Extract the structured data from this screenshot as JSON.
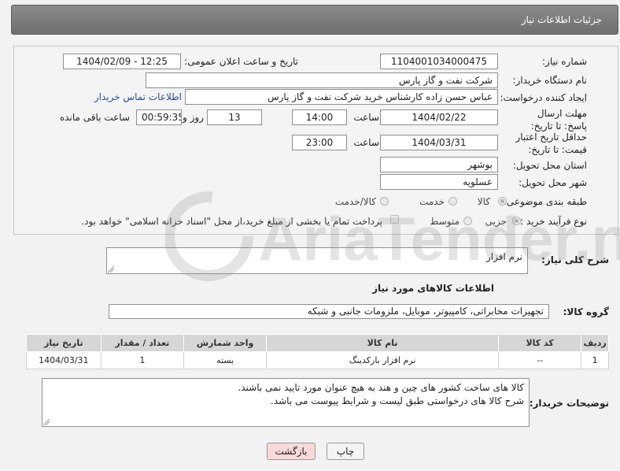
{
  "header": {
    "title": "جزئیات اطلاعات نیاز"
  },
  "form": {
    "need_number_label": "شماره نیاز:",
    "need_number": "1104001034000475",
    "announce_label": "تاریخ و ساعت اعلان عمومی:",
    "announce_value": "1404/02/09 - 12:25",
    "buyer_org_label": "نام دستگاه خریدار:",
    "buyer_org": "شرکت نفت و گاز پارس",
    "creator_label": "ایجاد کننده درخواست:",
    "creator": "عباس حسن زاده کارشناس خرید شرکت نفت و گاز پارس",
    "contact_link": "اطلاعات تماس خریدار",
    "deadline_label": "مهلت ارسال پاسخ: تا تاریخ:",
    "deadline_date": "1404/02/22",
    "time_label": "ساعت",
    "deadline_time": "14:00",
    "days_value": "13",
    "days_label": "روز و",
    "remaining_value": "00:59:35",
    "remaining_label": "ساعت باقی مانده",
    "validity_label": "حداقل تاریخ اعتبار قیمت: تا تاریخ:",
    "validity_date": "1404/03/31",
    "validity_time": "23:00",
    "province_label": "استان محل تحویل:",
    "province": "بوشهر",
    "city_label": "شهر محل تحویل:",
    "city": "عسلویه",
    "category_label": "طبقه بندی موضوعی:",
    "category_options": [
      "کالا",
      "خدمت",
      "کالا/خدمت"
    ],
    "category_selected": "کالا",
    "process_label": "نوع فرآیند خرید :",
    "process_options": [
      "جزیی",
      "متوسط"
    ],
    "process_selected": "جزیی",
    "payment_note": "پرداخت تمام یا بخشی از مبلغ خرید،از محل \"اسناد خزانه اسلامی\" خواهد بود."
  },
  "description": {
    "label": "شرح کلی نیاز:",
    "value": "نرم افزار"
  },
  "goods": {
    "section_title": "اطلاعات کالاهای مورد نیاز",
    "group_label": "گروه کالا:",
    "group_value": "تجهیزات مخابراتی، کامپیوتر، موبایل، ملزومات جانبی و شبکه",
    "columns": [
      "ردیف",
      "کد کالا",
      "نام کالا",
      "واحد شمارش",
      "تعداد / مقدار",
      "تاریخ نیاز"
    ],
    "rows": [
      [
        "1",
        "--",
        "نرم افزار بارکدینگ",
        "بسته",
        "1",
        "1404/03/31"
      ]
    ]
  },
  "buyer_notes": {
    "label": "توضیحات خریدار:",
    "line1": "کالا های ساخت کشور های چین و هند به هیچ عنوان مورد تایید نمی باشند.",
    "line2": "شرح کالا های درخواستی طبق لیست و شرایط پیوست می باشد."
  },
  "buttons": {
    "print": "چاپ",
    "back": "بازگشت"
  },
  "watermark": {
    "text": "AriaTender.net"
  },
  "colors": {
    "header": "#777777",
    "link": "#2a4ca0",
    "back_button": "#f9d9d9"
  }
}
